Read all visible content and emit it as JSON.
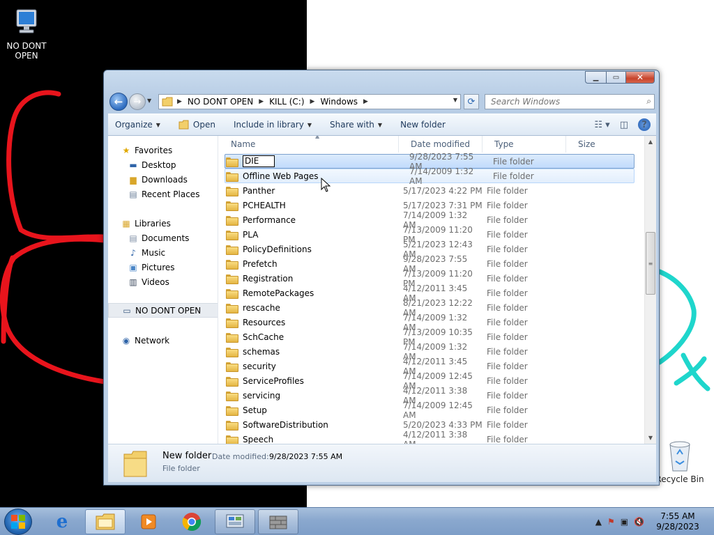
{
  "desktop": {
    "icons": [
      {
        "label_line1": "NO DONT",
        "label_line2": "OPEN"
      },
      {
        "label": "Recycle Bin"
      }
    ]
  },
  "window": {
    "nav": {
      "back_label": "Back",
      "forward_label": "Forward"
    },
    "address": {
      "crumbs": [
        "NO DONT OPEN",
        "KILL (C:)",
        "Windows"
      ]
    },
    "search": {
      "placeholder": "Search Windows"
    },
    "toolbar": {
      "organize": "Organize",
      "open": "Open",
      "include_in_library": "Include in library",
      "share_with": "Share with",
      "new_folder": "New folder"
    },
    "nav_pane": {
      "favorites": "Favorites",
      "desktop": "Desktop",
      "downloads": "Downloads",
      "recent_places": "Recent Places",
      "libraries": "Libraries",
      "documents": "Documents",
      "music": "Music",
      "pictures": "Pictures",
      "videos": "Videos",
      "computer": "NO DONT OPEN",
      "network": "Network"
    },
    "columns": {
      "name": "Name",
      "date_modified": "Date modified",
      "type": "Type",
      "size": "Size"
    },
    "files": [
      {
        "name": "DIE",
        "date": "9/28/2023 7:55 AM",
        "type": "File folder"
      },
      {
        "name": "Offline Web Pages",
        "date": "7/14/2009 1:32 AM",
        "type": "File folder"
      },
      {
        "name": "Panther",
        "date": "5/17/2023 4:22 PM",
        "type": "File folder"
      },
      {
        "name": "PCHEALTH",
        "date": "5/17/2023 7:31 PM",
        "type": "File folder"
      },
      {
        "name": "Performance",
        "date": "7/14/2009 1:32 AM",
        "type": "File folder"
      },
      {
        "name": "PLA",
        "date": "7/13/2009 11:20 PM",
        "type": "File folder"
      },
      {
        "name": "PolicyDefinitions",
        "date": "5/21/2023 12:43 AM",
        "type": "File folder"
      },
      {
        "name": "Prefetch",
        "date": "9/28/2023 7:55 AM",
        "type": "File folder"
      },
      {
        "name": "Registration",
        "date": "7/13/2009 11:20 PM",
        "type": "File folder"
      },
      {
        "name": "RemotePackages",
        "date": "4/12/2011 3:45 AM",
        "type": "File folder"
      },
      {
        "name": "rescache",
        "date": "8/21/2023 12:22 AM",
        "type": "File folder"
      },
      {
        "name": "Resources",
        "date": "7/14/2009 1:32 AM",
        "type": "File folder"
      },
      {
        "name": "SchCache",
        "date": "7/13/2009 10:35 PM",
        "type": "File folder"
      },
      {
        "name": "schemas",
        "date": "7/14/2009 1:32 AM",
        "type": "File folder"
      },
      {
        "name": "security",
        "date": "4/12/2011 3:45 AM",
        "type": "File folder"
      },
      {
        "name": "ServiceProfiles",
        "date": "7/14/2009 12:45 AM",
        "type": "File folder"
      },
      {
        "name": "servicing",
        "date": "4/12/2011 3:38 AM",
        "type": "File folder"
      },
      {
        "name": "Setup",
        "date": "7/14/2009 12:45 AM",
        "type": "File folder"
      },
      {
        "name": "SoftwareDistribution",
        "date": "5/20/2023 4:33 PM",
        "type": "File folder"
      },
      {
        "name": "Speech",
        "date": "4/12/2011 3:38 AM",
        "type": "File folder"
      }
    ],
    "details": {
      "name": "New folder",
      "date_label": "Date modified:",
      "date_value": "9/28/2023 7:55 AM",
      "type": "File folder"
    }
  },
  "taskbar": {
    "clock_time": "7:55 AM",
    "clock_date": "9/28/2023"
  },
  "colors": {
    "doodle_red": "#e8141c",
    "doodle_cyan": "#1fd6cc"
  }
}
